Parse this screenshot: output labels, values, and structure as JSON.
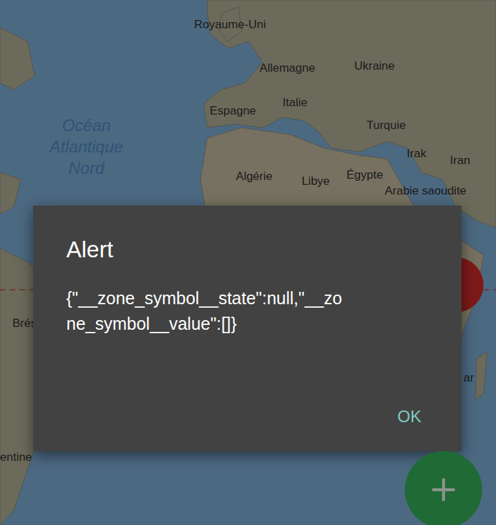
{
  "map": {
    "labels": [
      {
        "text": "Royaume-Uni",
        "kind": "country"
      },
      {
        "text": "Allemagne",
        "kind": "country"
      },
      {
        "text": "Ukraine",
        "kind": "country"
      },
      {
        "text": "Espagne",
        "kind": "country"
      },
      {
        "text": "Italie",
        "kind": "country"
      },
      {
        "text": "Turquie",
        "kind": "country"
      },
      {
        "text": "Océan Atlantique Nord",
        "kind": "ocean"
      },
      {
        "text": "Algérie",
        "kind": "country"
      },
      {
        "text": "Libye",
        "kind": "country"
      },
      {
        "text": "Égypte",
        "kind": "country"
      },
      {
        "text": "Irak",
        "kind": "country"
      },
      {
        "text": "Iran",
        "kind": "country"
      },
      {
        "text": "Arabie saoudite",
        "kind": "country"
      },
      {
        "text": "Brés",
        "kind": "country"
      },
      {
        "text": "entine",
        "kind": "country"
      },
      {
        "text": "ar",
        "kind": "country"
      }
    ]
  },
  "dialog": {
    "title": "Alert",
    "message": "{\"__zone_symbol__state\":null,\"__zone_symbol__value\":[]}",
    "buttons": [
      "OK"
    ]
  },
  "fab": {
    "icon": "+"
  }
}
